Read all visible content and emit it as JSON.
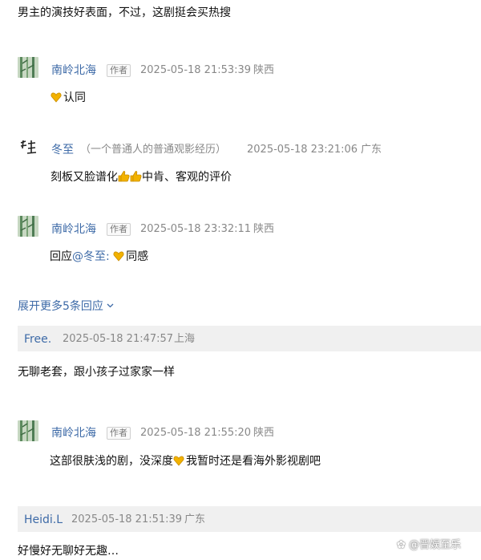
{
  "top_comment": {
    "text": "男主的演技好表面，不过，这剧挺会买热搜"
  },
  "replies": [
    {
      "name": "南岭北海",
      "badge": "作者",
      "time": "2025-05-18 21:53:39",
      "location": "陕西",
      "content": "认同",
      "avatar_icon": "bamboo-avatar-icon"
    },
    {
      "name": "冬至",
      "note": "（一个普通人的普通观影经历）",
      "time": "2025-05-18 23:21:06",
      "location": "广东",
      "content_a": "刻板又脸谱化",
      "content_b": "中肯、客观的评价",
      "avatar_icon": "ink-character-avatar-icon"
    },
    {
      "name": "南岭北海",
      "badge": "作者",
      "time": "2025-05-18 23:32:11",
      "location": "陕西",
      "reply_prefix": "回应",
      "mention": "@冬至:",
      "content": "同感",
      "avatar_icon": "bamboo-avatar-icon"
    }
  ],
  "expand_more": {
    "label": "展开更多5条回应"
  },
  "comment2": {
    "name": "Free.",
    "time": "2025-05-18 21:47:57",
    "location": "上海",
    "text": "无聊老套，跟小孩子过家家一样"
  },
  "reply4": {
    "name": "南岭北海",
    "badge": "作者",
    "time": "2025-05-18 21:55:20",
    "location": "陕西",
    "content_a": "这部很肤浅的剧，没深度",
    "content_b": "我暂时还是看海外影视剧吧"
  },
  "comment3": {
    "name": "Heidi.L",
    "time": "2025-05-18 21:51:39",
    "location": "广东",
    "text": "好慢好无聊好无趣…"
  },
  "watermark": {
    "text": "@晋娱至乐"
  },
  "colors": {
    "link": "#3d6aa7",
    "meta": "#888888",
    "bar": "#f0f0f0",
    "emoji": "#f2b200"
  }
}
